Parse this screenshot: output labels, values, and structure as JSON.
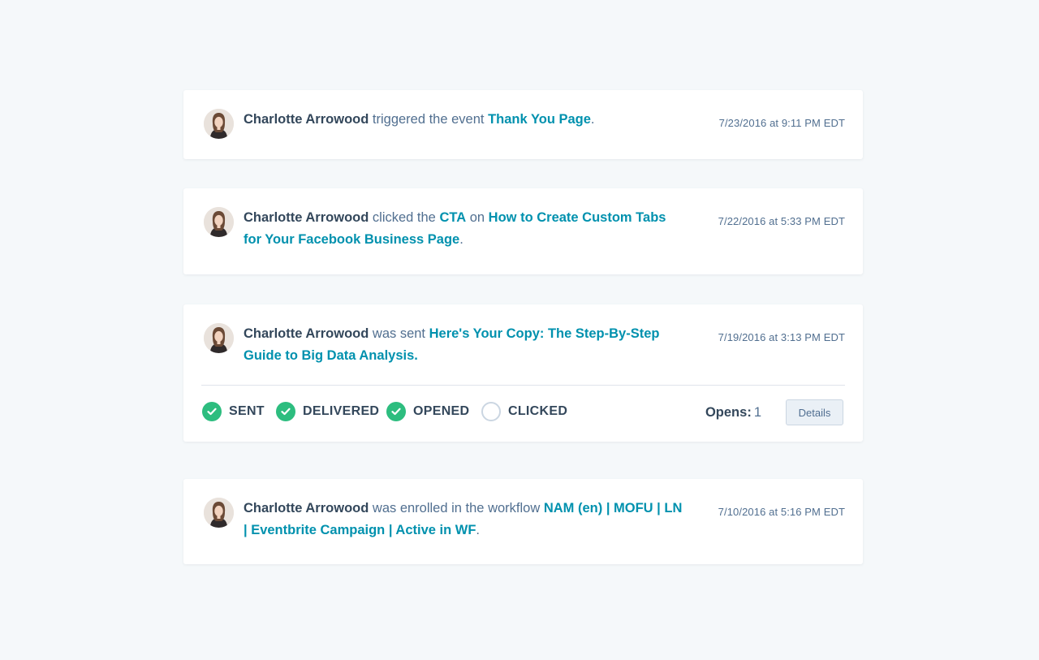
{
  "activities": [
    {
      "actor": "Charlotte Arrowood",
      "verb": " triggered the event ",
      "target": "Thank You Page",
      "end": ".",
      "timestamp": "7/23/2016 at 9:11 PM EDT"
    },
    {
      "actor": "Charlotte Arrowood",
      "verb": " clicked the ",
      "cta": "CTA",
      "prep": " on ",
      "target": "How to Create Custom Tabs for Your Facebook Business Page",
      "end": ".",
      "timestamp": "7/22/2016 at 5:33 PM EDT"
    },
    {
      "actor": "Charlotte Arrowood",
      "verb": " was sent ",
      "target": "Here's Your Copy: The Step-By-Step Guide to Big Data Analysis.",
      "timestamp": "7/19/2016 at 3:13 PM EDT",
      "email_statuses": [
        {
          "label": "SENT",
          "done": true
        },
        {
          "label": "DELIVERED",
          "done": true
        },
        {
          "label": "OPENED",
          "done": true
        },
        {
          "label": "CLICKED",
          "done": false
        }
      ],
      "opens_label": "Opens:",
      "opens_value": "1",
      "details_label": "Details"
    },
    {
      "actor": "Charlotte Arrowood",
      "verb": " was enrolled in the workflow ",
      "target": "NAM (en) | MOFU | LN | Eventbrite Campaign | Active in WF",
      "end": ".",
      "timestamp": "7/10/2016 at 5:16 PM EDT"
    }
  ],
  "colors": {
    "background": "#f5f8fa",
    "link": "#0091ae",
    "check": "#2dbd7f",
    "text_dark": "#33475b",
    "text_muted": "#516f90"
  },
  "icons": {
    "avatar": "person-avatar",
    "status_done": "check-circle-icon",
    "status_pending": "empty-circle-icon"
  }
}
